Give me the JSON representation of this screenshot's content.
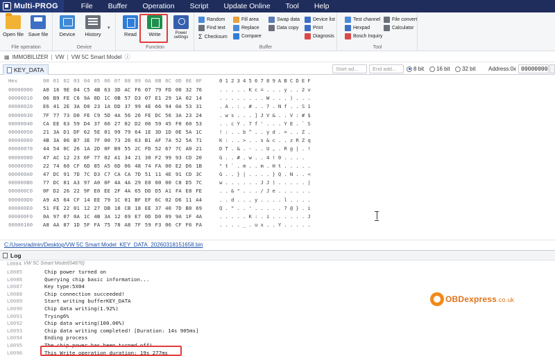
{
  "app": {
    "name": "Multi-PROG",
    "menu": [
      "File",
      "Buffer",
      "Operation",
      "Script",
      "Update Online",
      "Tool",
      "Help"
    ]
  },
  "ribbon": {
    "file_operation": {
      "label": "File operation",
      "open": "Open file",
      "save": "Save file"
    },
    "device_group": {
      "label": "Device",
      "device": "Device",
      "history": "History"
    },
    "function_group": {
      "label": "Function",
      "read": "Read",
      "write": "Write",
      "power": "Power settings"
    },
    "buffer_group": {
      "label": "Buffer",
      "items": [
        "Random",
        "Fill area",
        "Swap data",
        "Device list",
        "Find text",
        "Replace",
        "Data copy",
        "Print",
        "Checksum",
        "Compare",
        "Diagnosis"
      ]
    },
    "tool_group": {
      "label": "Tool",
      "items": [
        "Test channel",
        "File convert",
        "Hexpad",
        "Calculator",
        "Bosch Inquiry"
      ]
    }
  },
  "breadcrumb": [
    "IMMOBILIZER",
    "VW",
    "VW 5C Smart Model"
  ],
  "tab": {
    "name": "KEY_DATA",
    "start_placeholder": "Start ad...",
    "end_placeholder": "End add...",
    "bits": [
      "8 bit",
      "16 bit",
      "32 bit"
    ],
    "address_label": "Address:0x",
    "address_value": "00000000"
  },
  "hex": {
    "header_addr": "Hex",
    "header_bytes": "00 01 02 03 04 05 06 07 08 09 0A 0B 0C 0D 0E 0F",
    "header_ascii": "0123456789ABCDEF",
    "rows": [
      {
        "addr": "00000000",
        "bytes": "A0 16 9E 04 C5 4B 63 3D AC F6 07 79 FD 00 32 76",
        "ascii": ".....Kc=...y..2v"
      },
      {
        "addr": "00000010",
        "bytes": "06 B9 FE C6 9A 0D 1C 0B 57 D3 07 E1 29 1A 02 14",
        "ascii": "........W...)..."
      },
      {
        "addr": "00000020",
        "bytes": "E6 41 2E 3A D0 23 1A DD 37 99 4E 66 94 0A 53 31",
        "ascii": ".A.:.#..7.Nf..S1"
      },
      {
        "addr": "00000030",
        "bytes": "7F 77 73 D0 FE C9 5D 4A 56 26 FE DC 56 3A 23 24",
        "ascii": ".ws...]JV&..V:#$"
      },
      {
        "addr": "00000040",
        "bytes": "CA EE 63 59 D4 37 66 27 02 D2 06 59 45 F0 60 53",
        "ascii": "..cY.7f'...YE.`S"
      },
      {
        "addr": "00000050",
        "bytes": "21 3A D1 DF 62 5E 01 99 79 64 1E 3D 1D 0E 5A 1C",
        "ascii": "!:..b^..yd.=..Z."
      },
      {
        "addr": "00000060",
        "bytes": "4B 3A 06 B7 3E 7F 00 73 26 63 B1 AF 7A 52 5A 71",
        "ascii": "K:..>..s&c..zRZq"
      },
      {
        "addr": "00000070",
        "bytes": "44 54 0C 26 1A 2D 0F B9 55 2C FD 52 67 7C A0 21",
        "ascii": "DT.&.-..U,.Rg|.!"
      },
      {
        "addr": "00000080",
        "bytes": "47 AC 12 23 0F 77 02 A1 34 21 30 F2 99 93 CD 20",
        "ascii": "G..#.w..4!0.... "
      },
      {
        "addr": "00000090",
        "bytes": "22 74 60 CF 6D 85 A5 6D 06 48 74 FA 00 E2 D6 1B",
        "ascii": "\"t`.m..m.Ht....."
      },
      {
        "addr": "000000A0",
        "bytes": "47 DC 91 7D 7C D3 C7 CA CA 7D 51 11 4E 91 CD 3C",
        "ascii": "G..}|....}Q.N..<"
      },
      {
        "addr": "000000B0",
        "bytes": "77 DC 81 A3 97 A0 0F 4A 4A 29 E0 00 00 C8 D5 7C",
        "ascii": "w......JJ).....|"
      },
      {
        "addr": "000000C0",
        "bytes": "0F D2 26 22 9F E0 EE 2F 4A 65 DD D5 A1 FA E8 FE",
        "ascii": "..&\".../Je......"
      },
      {
        "addr": "000000D0",
        "bytes": "A9 A5 64 CF 14 EE 79 1C 01 BF EF 6C 02 D6 11 A4",
        "ascii": "..d...y....l...."
      },
      {
        "addr": "000000E0",
        "bytes": "51 FE 22 01 12 27 DB 18 CB 18 EE 37 40 7D B0 69",
        "ascii": "Q.\"..'.....7@}.i"
      },
      {
        "addr": "000000F0",
        "bytes": "0A 97 07 0A 1C 4B 3A 12 69 E7 0D D0 09 9A 1F 4A",
        "ascii": ".....K:.i......J"
      },
      {
        "addr": "00000100",
        "bytes": "A8 AA 87 1D 5F FA 75 78 A8 7F 59 F3 06 CF F6 FA",
        "ascii": "...._.ux..Y....."
      }
    ]
  },
  "file_path": "C:/Users/admin/Desktop/VW 5C Smart Model_KEY_DATA_20260318151658.bin",
  "log": {
    "title": "Log",
    "subtitle": "VW 5C Smart Model(64876)",
    "lines": [
      {
        "n": "L0085",
        "t": "Chip power turned on"
      },
      {
        "n": "L0086",
        "t": "Querying chip basic information..."
      },
      {
        "n": "L0087",
        "t": "Key type:5X04"
      },
      {
        "n": "L0088",
        "t": "Chip connection succeeded!"
      },
      {
        "n": "L0089",
        "t": "Start writing bufferKEY_DATA"
      },
      {
        "n": "L0090",
        "t": "Chip data writing(1.92%)"
      },
      {
        "n": "L0091",
        "t": "Trying6%"
      },
      {
        "n": "L0092",
        "t": "Chip data writing(100.00%)"
      },
      {
        "n": "L0093",
        "t": "Chip data writing completed! [Duration: 14s 905ms]"
      },
      {
        "n": "L0094",
        "t": "Ending process"
      },
      {
        "n": "L0095",
        "t": "The chip power has been turned off!"
      },
      {
        "n": "L0096",
        "t": "This Write operation duration: 19s 277ms"
      }
    ]
  },
  "watermark": {
    "brand": "OBDexpress",
    "domain": ".co.uk"
  },
  "colors": {
    "titlebar": "#1f2d5c",
    "highlight": "#e23b3b",
    "accent": "#1f5fbf",
    "watermark": "#e07318"
  }
}
